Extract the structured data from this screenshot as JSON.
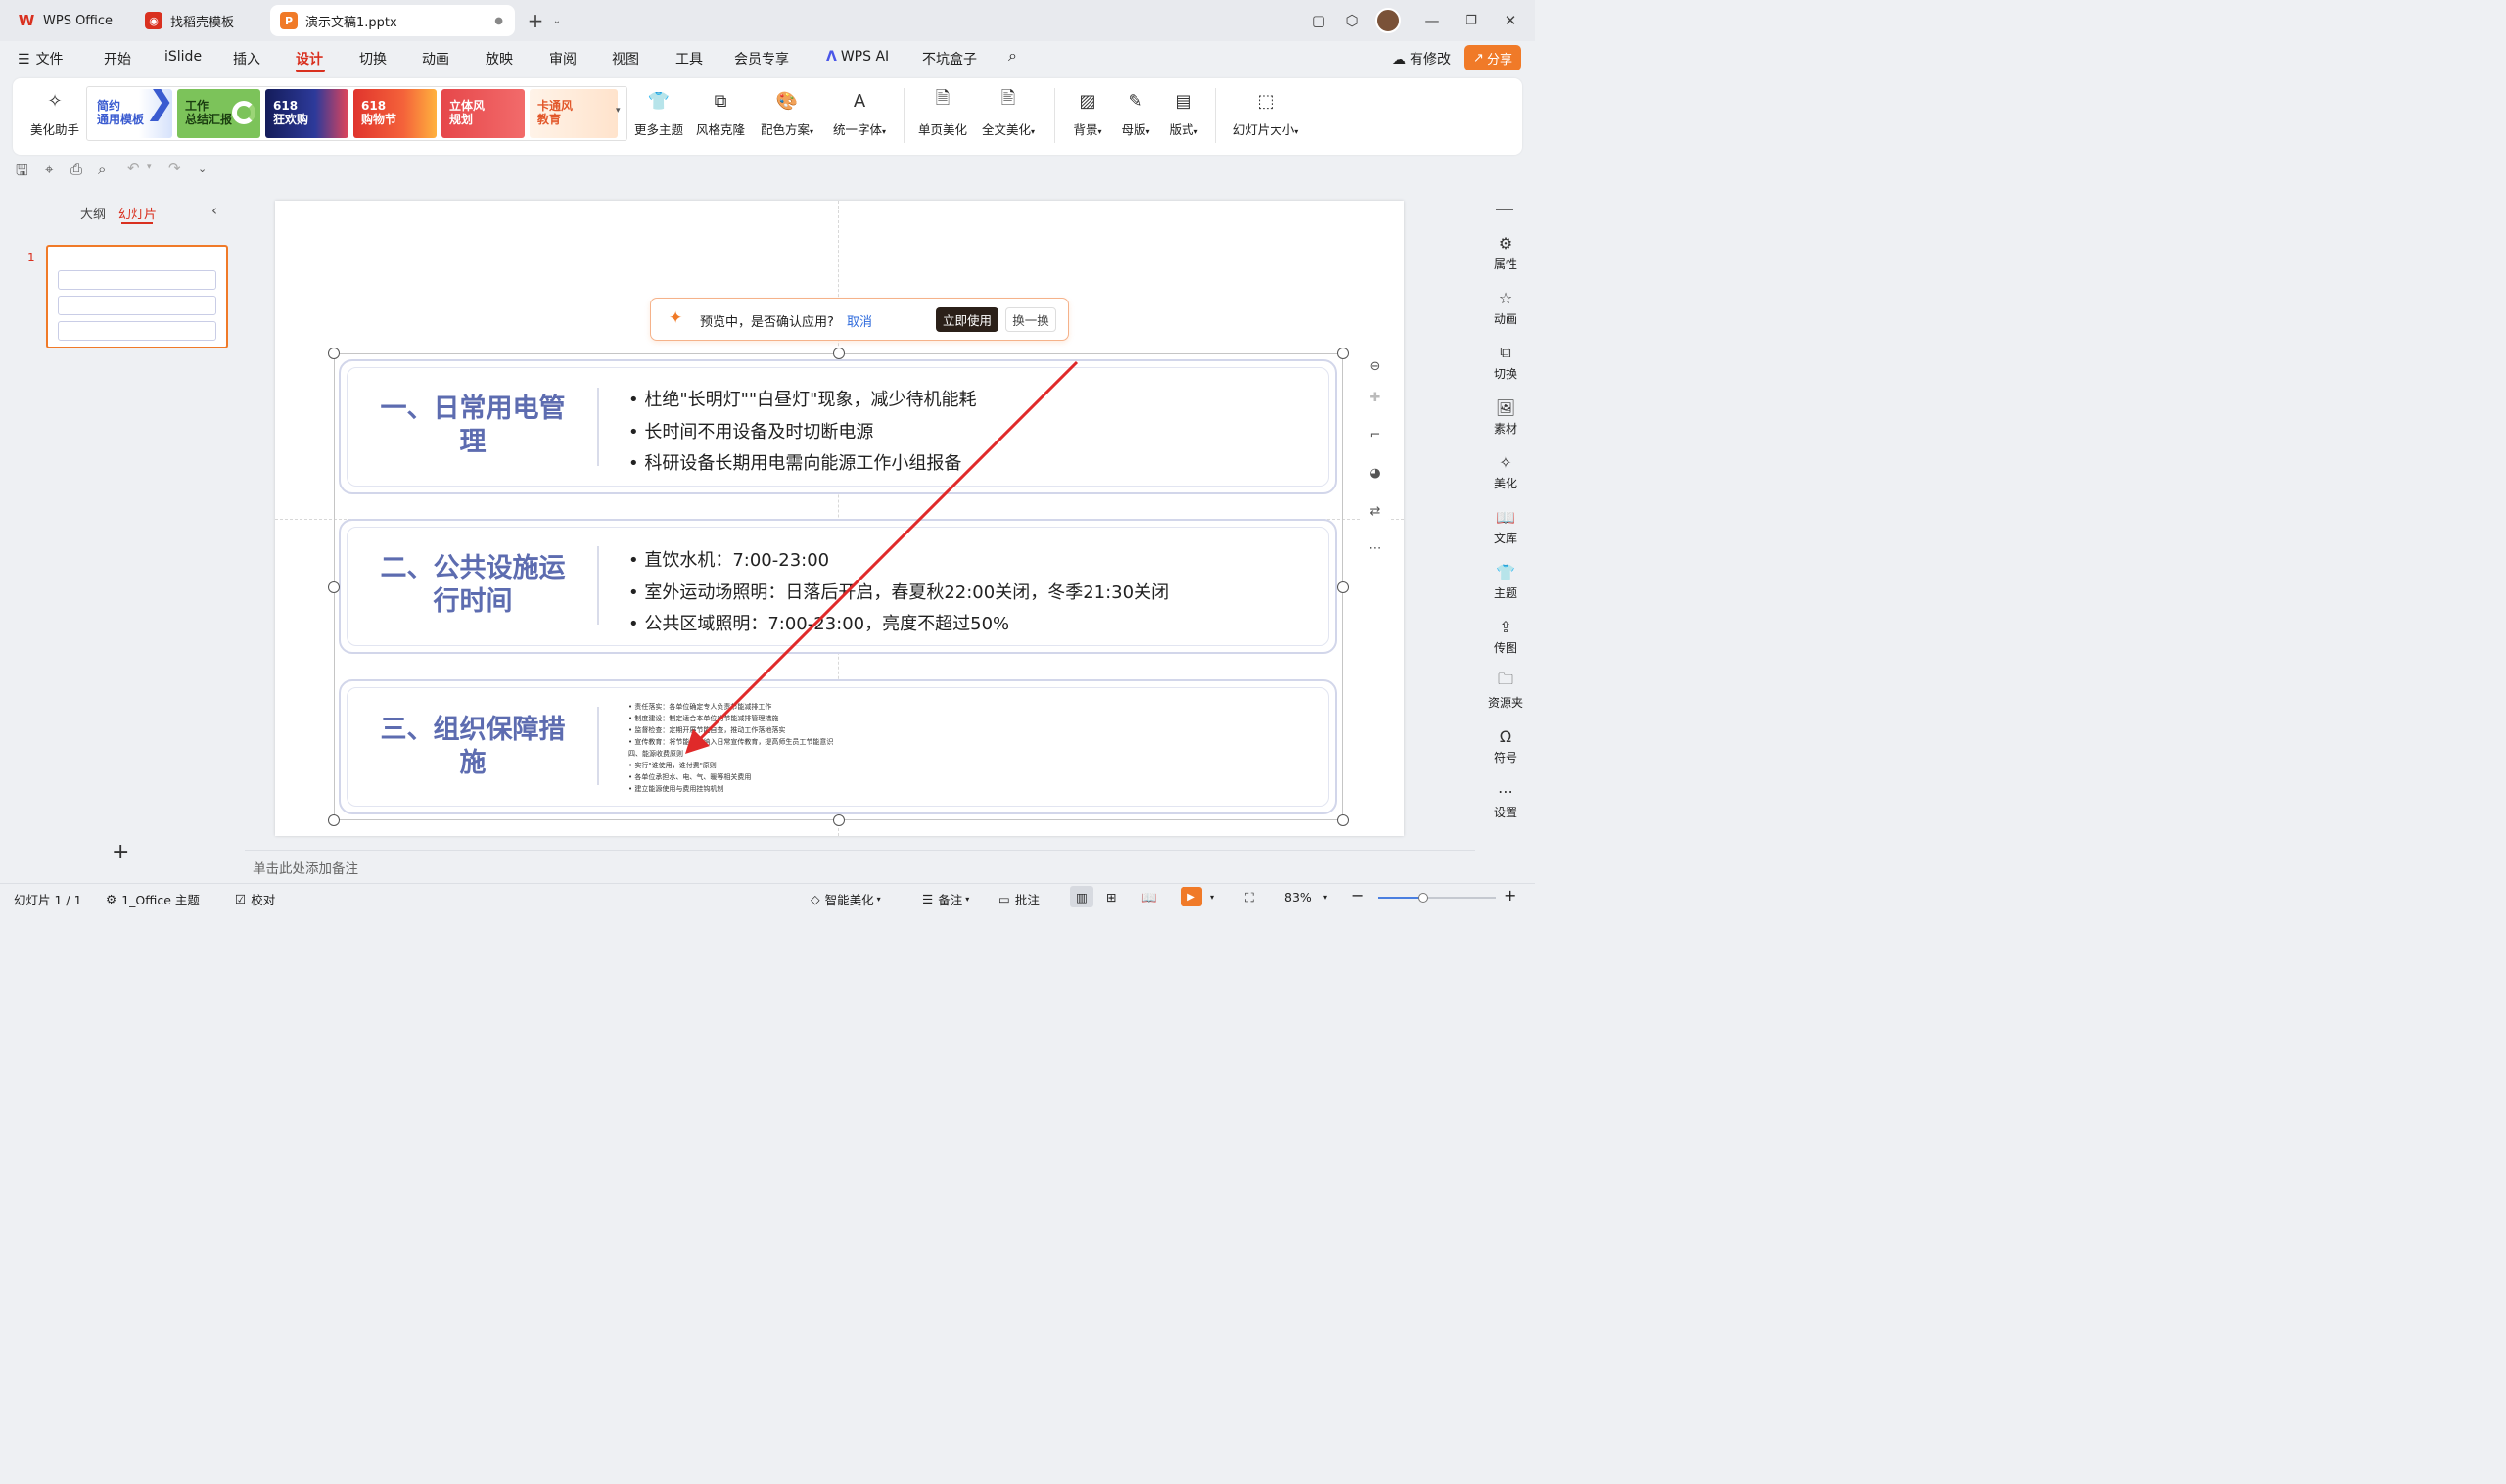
{
  "titlebar": {
    "tabs": [
      {
        "label": "WPS Office",
        "icon": "wps-logo"
      },
      {
        "label": "找稻壳模板",
        "icon": "docer-logo"
      },
      {
        "label": "演示文稿1.pptx",
        "icon": "presentation-icon",
        "active": true
      }
    ],
    "new_tab": "+"
  },
  "menubar": {
    "file": "文件",
    "items": [
      "开始",
      "iSlide",
      "插入",
      "设计",
      "切换",
      "动画",
      "放映",
      "审阅",
      "视图",
      "工具",
      "会员专享",
      "WPS AI",
      "不坑盒子"
    ],
    "active": "设计",
    "has_changes": "有修改",
    "share": "分享"
  },
  "ribbon": {
    "beautify_helper": "美化助手",
    "templates": [
      {
        "l1": "简约",
        "l2": "通用模板",
        "color": "#ffffff"
      },
      {
        "l1": "工作",
        "l2": "总结汇报",
        "color": "#7cc35a"
      },
      {
        "l1": "618",
        "l2": "狂欢购",
        "color": "#1d2a7a"
      },
      {
        "l1": "618",
        "l2": "购物节",
        "color": "#e0342d"
      },
      {
        "l1": "立体风",
        "l2": "规划",
        "color": "#e6474a"
      },
      {
        "l1": "卡通风",
        "l2": "教育",
        "color": "#fff3e8"
      }
    ],
    "buttons": [
      "更多主题",
      "风格克隆",
      "配色方案",
      "统一字体",
      "单页美化",
      "全文美化",
      "背景",
      "母版",
      "版式",
      "幻灯片大小"
    ]
  },
  "leftpanel": {
    "tab_outline": "大纲",
    "tab_slides": "幻灯片",
    "slide_number": "1",
    "add": "+"
  },
  "preview_bar": {
    "text": "预览中，是否确认应用?",
    "cancel": "取消",
    "apply": "立即使用",
    "swap": "换一换"
  },
  "slide": {
    "sections": [
      {
        "heading_l1": "一、日常用电管",
        "heading_l2": "理",
        "bullets": [
          "• 杜绝\"长明灯\"\"白昼灯\"现象，减少待机能耗",
          "• 长时间不用设备及时切断电源",
          "• 科研设备长期用电需向能源工作小组报备"
        ]
      },
      {
        "heading_l1": "二、公共设施运",
        "heading_l2": "行时间",
        "bullets": [
          "• 直饮水机：7:00-23:00",
          "• 室外运动场照明：日落后开启，春夏秋22:00关闭，冬季21:30关闭",
          "• 公共区域照明：7:00-23:00，亮度不超过50%"
        ]
      },
      {
        "heading_l1": "三、组织保障措",
        "heading_l2": "施",
        "bullets": [
          "• 责任落实：各单位确定专人负责节能减排工作",
          "• 制度建设：制定适合本单位的节能减排管理措施",
          "• 监督检查：定期开展节能自查，推动工作落地落实",
          "• 宣传教育：将节能工作纳入日常宣传教育，提高师生员工节能意识",
          "四、能源收费原则",
          "• 实行\"谁使用，谁付费\"原则",
          "• 各单位承担水、电、气、暖等相关费用",
          "• 建立能源使用与费用挂钩机制"
        ]
      }
    ]
  },
  "rightrail": [
    "属性",
    "动画",
    "切换",
    "素材",
    "美化",
    "文库",
    "主题",
    "传图",
    "资源夹",
    "符号",
    "设置"
  ],
  "notes": {
    "placeholder": "单击此处添加备注"
  },
  "status": {
    "slide_count": "幻灯片 1 / 1",
    "theme": "1_Office 主题",
    "proof": "校对",
    "smart": "智能美化",
    "notes": "备注",
    "comments": "批注",
    "zoom": "83%"
  },
  "colors": {
    "accent": "#d9301f",
    "heading": "#5d6cb0",
    "orange": "#f07a28"
  }
}
